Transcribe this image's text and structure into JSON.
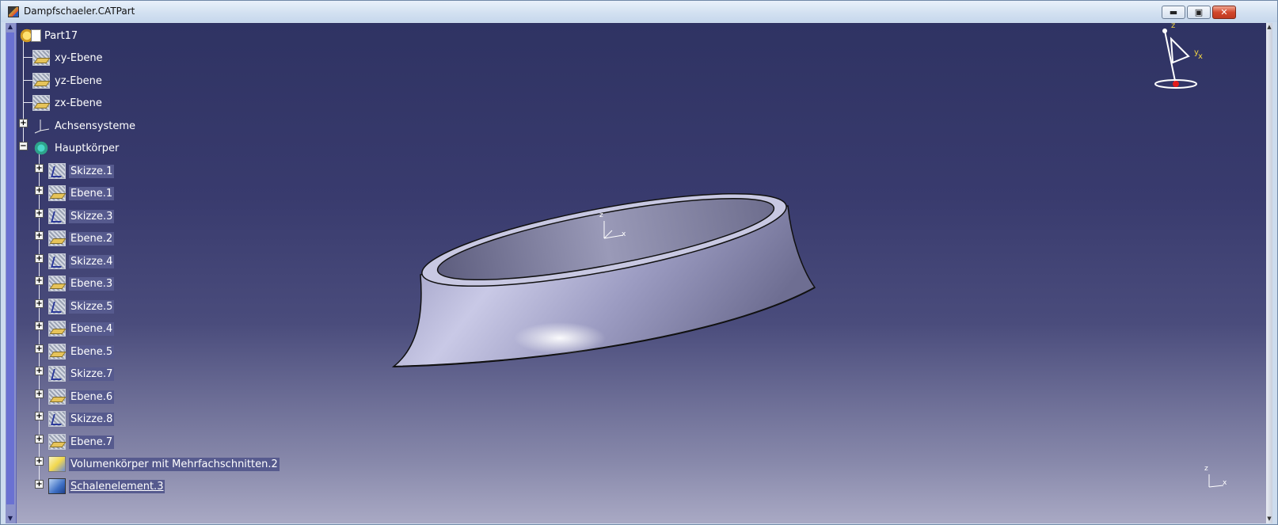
{
  "window": {
    "title": "Dampfschaeler.CATPart",
    "buttons": {
      "minimize": "▬",
      "maximize": "▣",
      "close": "✕"
    }
  },
  "tree": {
    "root": "Part17",
    "items": [
      {
        "label": "xy-Ebene",
        "icon": "plane-icon"
      },
      {
        "label": "yz-Ebene",
        "icon": "plane-icon"
      },
      {
        "label": "zx-Ebene",
        "icon": "plane-icon"
      },
      {
        "label": "Achsensysteme",
        "icon": "axis-system-icon"
      },
      {
        "label": "Hauptkörper",
        "icon": "body-icon"
      }
    ],
    "children": [
      {
        "label": "Skizze.1",
        "icon": "sketch-icon"
      },
      {
        "label": "Ebene.1",
        "icon": "plane-icon"
      },
      {
        "label": "Skizze.3",
        "icon": "sketch-icon"
      },
      {
        "label": "Ebene.2",
        "icon": "plane-icon"
      },
      {
        "label": "Skizze.4",
        "icon": "sketch-icon"
      },
      {
        "label": "Ebene.3",
        "icon": "plane-icon"
      },
      {
        "label": "Skizze.5",
        "icon": "sketch-icon"
      },
      {
        "label": "Ebene.4",
        "icon": "plane-icon"
      },
      {
        "label": "Ebene.5",
        "icon": "plane-icon"
      },
      {
        "label": "Skizze.7",
        "icon": "sketch-icon"
      },
      {
        "label": "Ebene.6",
        "icon": "plane-icon"
      },
      {
        "label": "Skizze.8",
        "icon": "sketch-icon"
      },
      {
        "label": "Ebene.7",
        "icon": "plane-icon"
      },
      {
        "label": "Volumenkörper mit Mehrfachschnitten.2",
        "icon": "multi-section-solid-icon"
      },
      {
        "label": "Schalenelement.3",
        "icon": "shell-icon"
      }
    ]
  },
  "compass": {
    "z": "z",
    "y": "y",
    "x": "x"
  },
  "model_axis": {
    "z": "z",
    "x": "x"
  },
  "corner_axis": {
    "z": "z",
    "x": "x"
  },
  "colors": {
    "viewport_top": "#2f3363",
    "viewport_bottom": "#a9a9c4",
    "label_highlight": "#565a8e",
    "model": "#b9b9d8"
  }
}
